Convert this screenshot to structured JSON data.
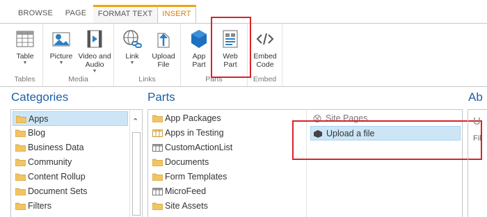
{
  "tabs": [
    "BROWSE",
    "PAGE",
    "FORMAT TEXT",
    "INSERT"
  ],
  "ribbon": {
    "groups": [
      {
        "label": "Tables",
        "buttons": [
          {
            "label": "Table",
            "has_dropdown": true,
            "icon": "table-icon"
          }
        ]
      },
      {
        "label": "Media",
        "buttons": [
          {
            "label": "Picture",
            "has_dropdown": true,
            "icon": "picture-icon"
          },
          {
            "label": "Video and Audio",
            "has_dropdown": true,
            "icon": "video-audio-icon"
          }
        ]
      },
      {
        "label": "Links",
        "buttons": [
          {
            "label": "Link",
            "has_dropdown": true,
            "icon": "link-icon"
          },
          {
            "label": "Upload File",
            "has_dropdown": false,
            "icon": "upload-icon"
          }
        ]
      },
      {
        "label": "Parts",
        "buttons": [
          {
            "label": "App Part",
            "has_dropdown": false,
            "icon": "app-part-icon"
          },
          {
            "label": "Web Part",
            "has_dropdown": false,
            "icon": "web-part-icon"
          }
        ]
      },
      {
        "label": "Embed",
        "buttons": [
          {
            "label": "Embed Code",
            "has_dropdown": false,
            "icon": "embed-code-icon"
          }
        ]
      }
    ]
  },
  "categories": {
    "title": "Categories",
    "items": [
      "Apps",
      "Blog",
      "Business Data",
      "Community",
      "Content Rollup",
      "Document Sets",
      "Filters"
    ],
    "selected": "Apps"
  },
  "parts": {
    "title": "Parts",
    "left_items": [
      "App Packages",
      "Apps in Testing",
      "CustomActionList",
      "Documents",
      "Form Templates",
      "MicroFeed",
      "Site Assets"
    ],
    "right_items": [
      "Site Pages",
      "Upload a file"
    ],
    "selected": "Upload a file"
  },
  "about": {
    "title": "Ab",
    "line1": "U",
    "line2": "Fil"
  },
  "colors": {
    "accent_orange": "#f0a30a",
    "title_blue": "#1c5fa6",
    "highlight_red": "#d9222a",
    "selection_blue": "#cde6f7"
  }
}
